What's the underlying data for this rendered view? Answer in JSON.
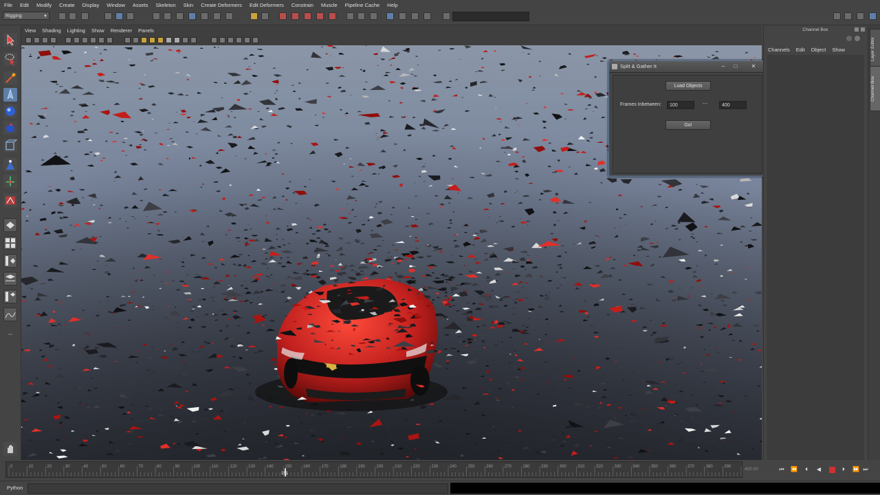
{
  "menubar": {
    "items": [
      "File",
      "Edit",
      "Modify",
      "Create",
      "Display",
      "Window",
      "Assets",
      "Skeleton",
      "Skin",
      "Create Deformers",
      "Edit Deformers",
      "Constrain",
      "Muscle",
      "Pipeline Cache",
      "Help"
    ]
  },
  "statusline": {
    "mode": "Rigging"
  },
  "viewport_menu": {
    "items": [
      "View",
      "Shading",
      "Lighting",
      "Show",
      "Renderer",
      "Panels"
    ]
  },
  "channel_box": {
    "title": "Channel Box",
    "menu": [
      "Channels",
      "Edit",
      "Object",
      "Show"
    ],
    "side_tabs": [
      "Layer Editor",
      "Channel Box"
    ]
  },
  "dialog": {
    "title": "Split & Gather It",
    "load_objects_label": "Load Objects",
    "frames_label": "Frames Inbetween:",
    "frames_start": "100",
    "separator": "---",
    "frames_end": "400",
    "go_label": "Go!"
  },
  "timeslider": {
    "ticks": [
      "0",
      "10",
      "20",
      "30",
      "40",
      "50",
      "60",
      "70",
      "80",
      "90",
      "100",
      "110",
      "120",
      "130",
      "140",
      "150",
      "160",
      "170",
      "180",
      "190",
      "200",
      "210",
      "220",
      "230",
      "240",
      "250",
      "260",
      "270",
      "280",
      "290",
      "300",
      "310",
      "320",
      "330",
      "340",
      "350",
      "360",
      "370",
      "380",
      "390",
      "400"
    ],
    "current_frame": "151",
    "range_end": "400.00"
  },
  "command_line": {
    "label": "Python"
  },
  "icons": [
    "select-tool-icon",
    "lasso-tool-icon",
    "paint-select-icon",
    "move-tool-icon",
    "rotate-tool-icon",
    "scale-tool-icon",
    "play-icon",
    "stop-icon"
  ],
  "colors": {
    "accent": "#5e7fa8",
    "car_red": "#c0201e",
    "stop_red": "#d03030"
  }
}
